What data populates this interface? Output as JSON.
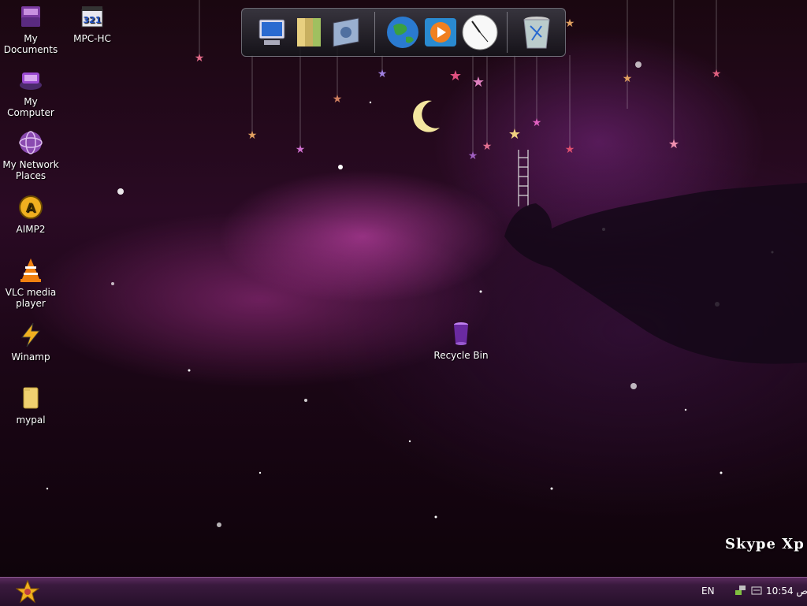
{
  "desktop": {
    "icons": [
      {
        "label": "My Documents",
        "icon": "my-documents-icon"
      },
      {
        "label": "MPC-HC",
        "icon": "mpc-hc-icon"
      },
      {
        "label": "My Computer",
        "icon": "my-computer-icon"
      },
      {
        "label": "My Network Places",
        "icon": "network-places-icon"
      },
      {
        "label": "AIMP2",
        "icon": "aimp2-icon"
      },
      {
        "label": "VLC media player",
        "icon": "vlc-icon"
      },
      {
        "label": "Winamp",
        "icon": "winamp-icon"
      },
      {
        "label": "mypal",
        "icon": "folder-icon"
      },
      {
        "label": "Recycle Bin",
        "icon": "recycle-bin-icon"
      }
    ],
    "watermark": "Skype Xp"
  },
  "dock": {
    "items": [
      "computer-icon",
      "documents-folder-icon",
      "control-panel-icon",
      "globe-browser-icon",
      "media-player-icon",
      "clock-icon",
      "trash-icon"
    ]
  },
  "taskbar": {
    "language": "EN",
    "clock_time": "10:54",
    "clock_ampm": "ص",
    "tray_icons": [
      "network-tray-icon",
      "volume-tray-icon"
    ]
  },
  "colors": {
    "taskbar": "#3a1a3e",
    "nebula": "#e050c8"
  }
}
